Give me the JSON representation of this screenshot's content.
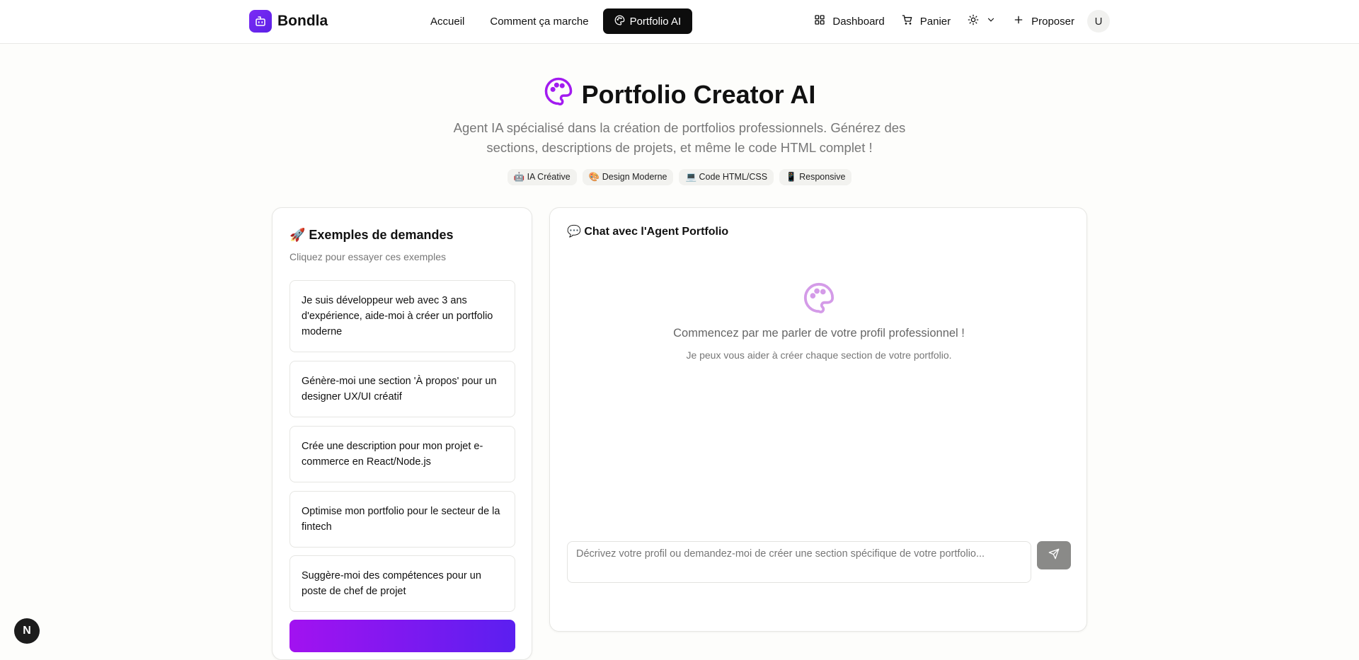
{
  "brand": {
    "name": "Bondla",
    "accent": "#6d28f0"
  },
  "nav": {
    "items": [
      {
        "label": "Accueil",
        "active": false
      },
      {
        "label": "Comment ça marche",
        "active": false
      },
      {
        "label": "Portfolio AI",
        "active": true,
        "icon": "palette-icon"
      }
    ]
  },
  "right_nav": {
    "dashboard": "Dashboard",
    "cart": "Panier",
    "propose": "Proposer",
    "avatar": "U",
    "theme_icon": "sun-icon"
  },
  "hero": {
    "title": "Portfolio Creator AI",
    "subtitle": "Agent IA spécialisé dans la création de portfolios professionnels. Générez des sections, descriptions de projets, et même le code HTML complet !",
    "tags": [
      "🤖 IA Créative",
      "🎨 Design Moderne",
      "💻 Code HTML/CSS",
      "📱 Responsive"
    ]
  },
  "examples": {
    "title": "🚀 Exemples de demandes",
    "subtitle": "Cliquez pour essayer ces exemples",
    "items": [
      "Je suis développeur web avec 3 ans d'expérience, aide-moi à créer un portfolio moderne",
      "Génère-moi une section 'À propos' pour un designer UX/UI créatif",
      "Crée une description pour mon projet e-commerce en React/Node.js",
      "Optimise mon portfolio pour le secteur de la fintech",
      "Suggère-moi des compétences pour un poste de chef de projet"
    ]
  },
  "chat": {
    "title": "💬 Chat avec l'Agent Portfolio",
    "empty_main": "Commencez par me parler de votre profil professionnel !",
    "empty_sub": "Je peux vous aider à créer chaque section de votre portfolio.",
    "placeholder": "Décrivez votre profil ou demandez-moi de créer une section spécifique de votre portfolio..."
  },
  "dev_badge": "N"
}
